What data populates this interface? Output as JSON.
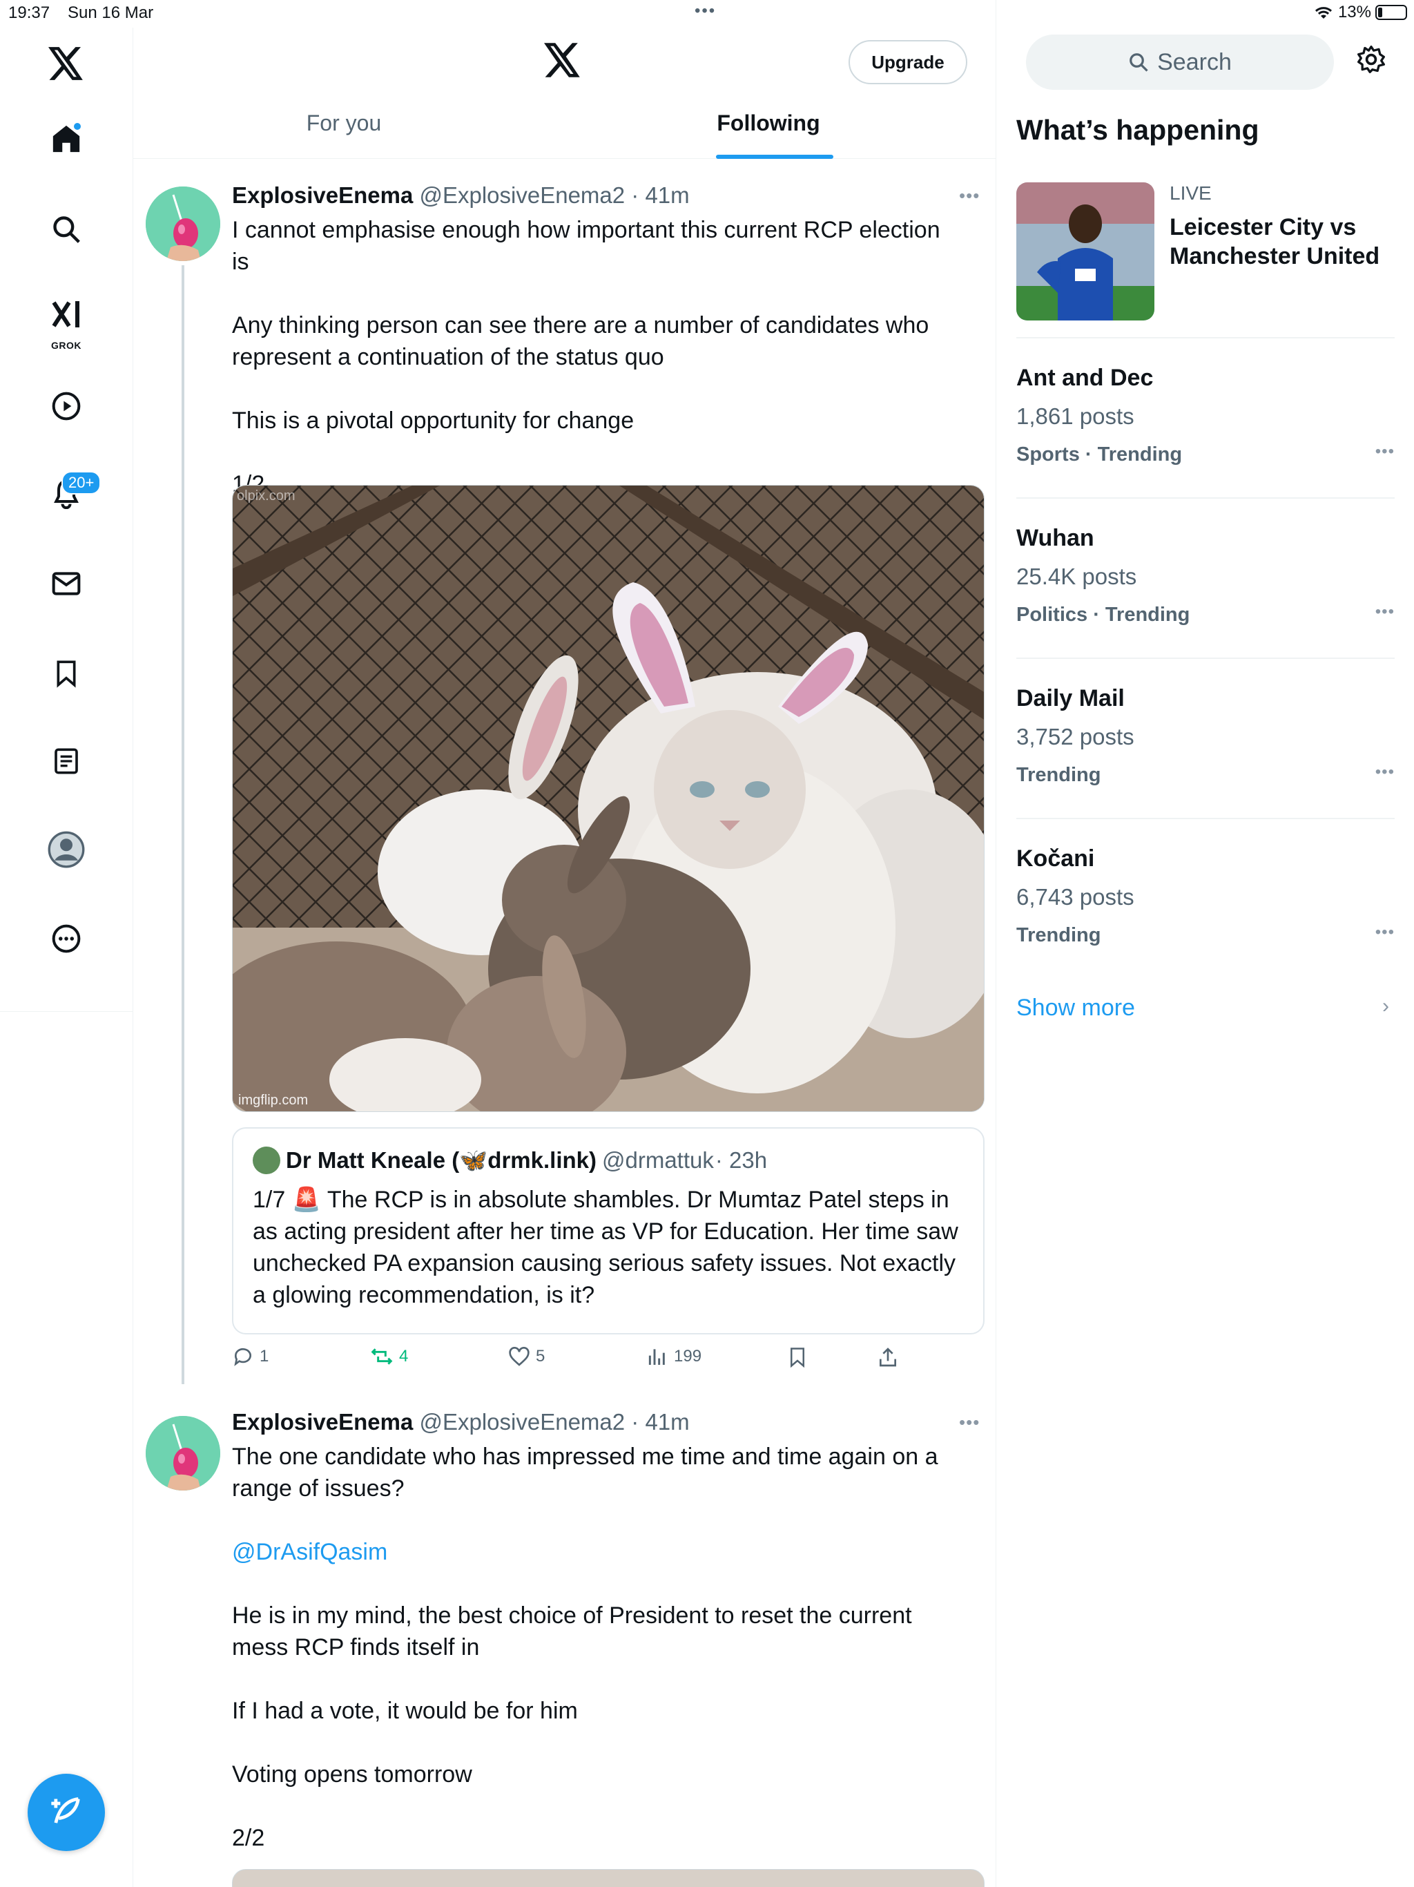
{
  "status_bar": {
    "time": "19:37",
    "date": "Sun 16 Mar",
    "battery": "13%"
  },
  "nav": {
    "grok_label": "GROK",
    "notifications_badge": "20+"
  },
  "header": {
    "upgrade_label": "Upgrade",
    "tabs": [
      {
        "label": "For you",
        "active": false
      },
      {
        "label": "Following",
        "active": true
      }
    ]
  },
  "posts": [
    {
      "name": "ExplosiveEnema",
      "handle": "@ExplosiveEnema2",
      "time": "· 41m",
      "paragraphs": [
        "I cannot emphasise enough how important this current RCP election is",
        "Any thinking person can see there are a number of candidates who represent a continuation of the status quo",
        "This is a pivotal opportunity for change",
        "1/2"
      ],
      "image_watermark_top": "olpix.com",
      "image_watermark_bottom": "imgflip.com",
      "quote": {
        "name": "Dr Matt Kneale (🦋drmk.link)",
        "handle": "@drmattuk",
        "time": "· 23h",
        "text": "1/7 🚨 The RCP is in absolute shambles. Dr Mumtaz Patel steps in as acting president after her time as VP for Education. Her time saw unchecked PA expansion causing serious safety issues. Not exactly a glowing recommendation, is it?"
      },
      "actions": {
        "replies": "1",
        "reposts": "4",
        "likes": "5",
        "views": "199"
      }
    },
    {
      "name": "ExplosiveEnema",
      "handle": "@ExplosiveEnema2",
      "time": "· 41m",
      "paragraphs": [
        "The one candidate who has impressed me time and time again on a range of issues?",
        "@DrAsifQasim",
        "He is in my mind, the best choice of President to reset the current mess RCP finds itself in",
        "If I had a vote, it would be for him",
        "Voting opens tomorrow",
        "2/2"
      ]
    }
  ],
  "sidebar": {
    "search_placeholder": "Search",
    "title": "What’s happening",
    "live": {
      "label": "LIVE",
      "title": "Leicester City vs Manchester United"
    },
    "trends": [
      {
        "name": "Ant and Dec",
        "count": "1,861 posts",
        "category": "Sports · Trending"
      },
      {
        "name": "Wuhan",
        "count": "25.4K posts",
        "category": "Politics · Trending"
      },
      {
        "name": "Daily Mail",
        "count": "3,752 posts",
        "category": "Trending"
      },
      {
        "name": "Kočani",
        "count": "6,743 posts",
        "category": "Trending"
      }
    ],
    "show_more": "Show more"
  },
  "colors": {
    "accent": "#1d9bf0",
    "repost_green": "#00ba7c",
    "text_primary": "#0f1419",
    "text_secondary": "#536471"
  }
}
